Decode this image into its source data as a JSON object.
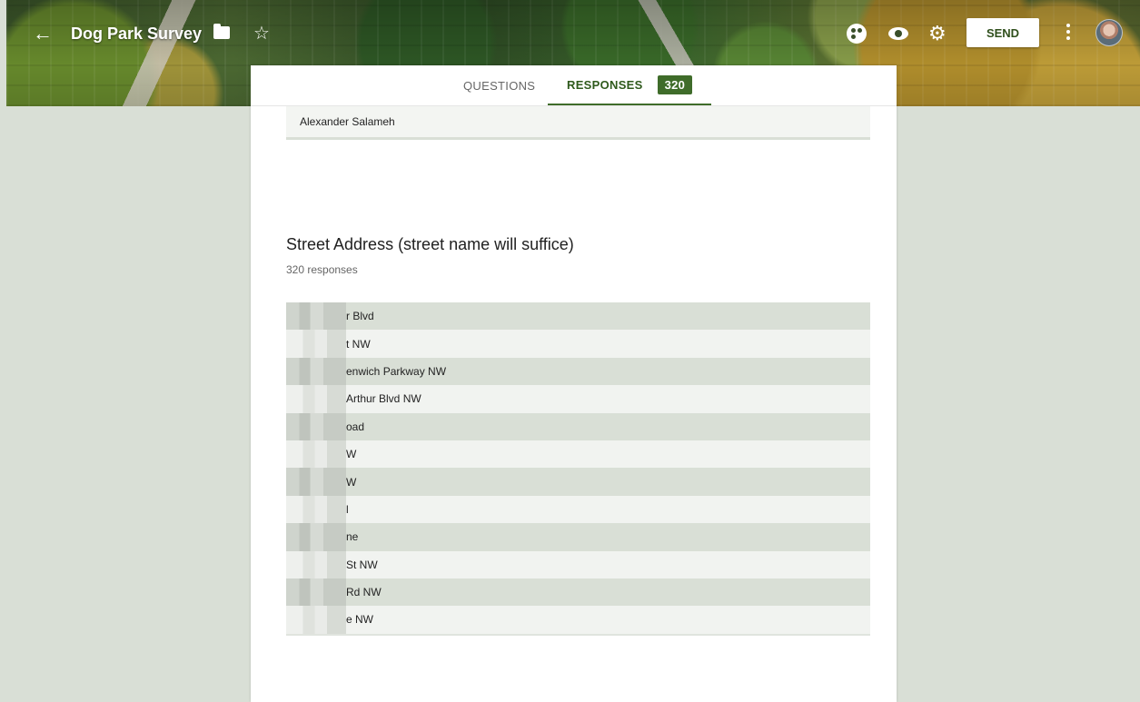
{
  "header": {
    "title": "Dog Park Survey",
    "send_label": "SEND",
    "icons": [
      "back-arrow-icon",
      "folder-icon",
      "star-icon",
      "palette-icon",
      "eye-icon",
      "gear-icon",
      "more-vert-icon"
    ]
  },
  "tabs": {
    "questions_label": "QUESTIONS",
    "responses_label": "RESPONSES",
    "responses_count": "320"
  },
  "previous_question": {
    "last_response": "Alexander Salameh"
  },
  "question": {
    "title": "Street Address (street name will suffice)",
    "response_count": "320 responses",
    "responses": [
      "r Blvd",
      "t NW",
      "enwich Parkway NW",
      "Arthur Blvd NW",
      "oad",
      "W",
      "W",
      "l",
      "ne",
      " St NW",
      "Rd NW",
      "e NW"
    ]
  },
  "colors": {
    "accent": "#3f6c2a",
    "background": "#d9dfd6"
  }
}
